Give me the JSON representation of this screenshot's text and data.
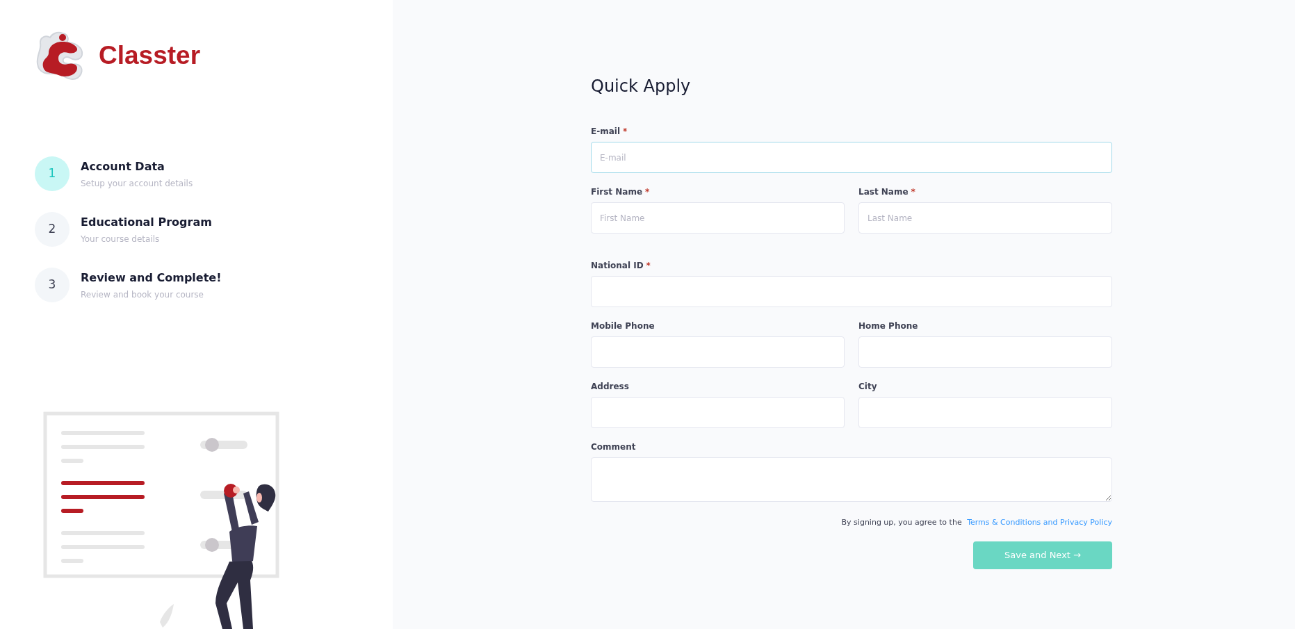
{
  "brand": {
    "name": "Classter"
  },
  "steps": [
    {
      "number": "1",
      "title": "Account Data",
      "subtitle": "Setup your account details",
      "selected": true
    },
    {
      "number": "2",
      "title": "Educational Program",
      "subtitle": "Your course details",
      "selected": false
    },
    {
      "number": "3",
      "title": "Review and Complete!",
      "subtitle": "Review and book your course",
      "selected": false
    }
  ],
  "form": {
    "title": "Quick Apply",
    "rows": [
      [
        {
          "label": "E-mail",
          "required": true,
          "placeholder": "E-mail",
          "kind": "input",
          "focused": true
        }
      ],
      [
        {
          "label": "First Name",
          "required": true,
          "placeholder": "First Name",
          "kind": "input",
          "focused": false
        },
        {
          "label": "Last Name",
          "required": true,
          "placeholder": "Last Name",
          "kind": "input",
          "focused": false
        }
      ],
      [
        {
          "label": "National ID",
          "required": true,
          "kind": "input",
          "focused": false
        }
      ],
      [
        {
          "label": "Mobile Phone",
          "required": false,
          "kind": "input",
          "focused": false
        },
        {
          "label": "Home Phone",
          "required": false,
          "kind": "input",
          "focused": false
        }
      ],
      [
        {
          "label": "Address",
          "required": false,
          "kind": "input",
          "focused": false
        },
        {
          "label": "City",
          "required": false,
          "kind": "input",
          "focused": false
        }
      ],
      [
        {
          "label": "Comment",
          "required": false,
          "kind": "textarea",
          "focused": false
        }
      ]
    ],
    "required_mark": "*",
    "agreement": {
      "text": "By signing up, you agree to the",
      "link": "Terms & Conditions and Privacy Policy"
    },
    "submit": "Save and Next →"
  }
}
